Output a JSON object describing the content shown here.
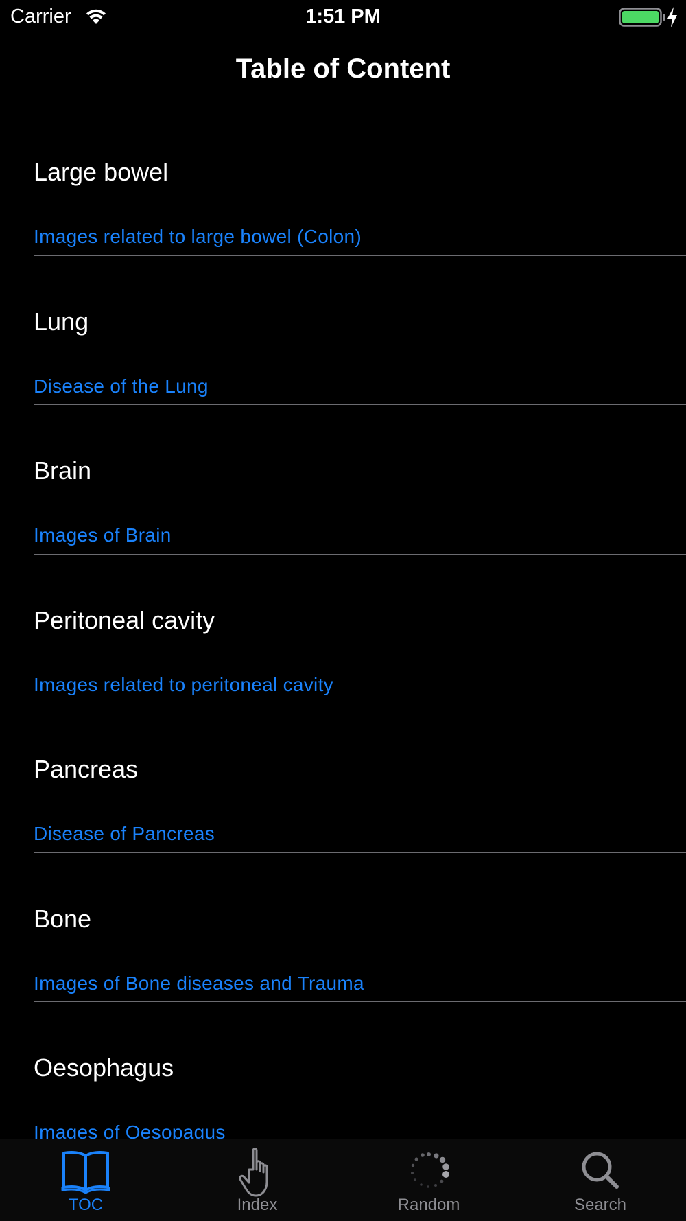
{
  "status_bar": {
    "carrier": "Carrier",
    "time": "1:51 PM",
    "wifi_icon": "wifi-icon",
    "battery_icon": "battery-full-icon",
    "charging_icon": "charging-bolt-icon"
  },
  "nav": {
    "title": "Table of Content"
  },
  "toc": {
    "items": [
      {
        "title": "Large bowel",
        "subtitle": "Images related to large bowel (Colon)"
      },
      {
        "title": "Lung",
        "subtitle": "Disease of the Lung"
      },
      {
        "title": "Brain",
        "subtitle": "Images of Brain"
      },
      {
        "title": "Peritoneal cavity",
        "subtitle": "Images related to peritoneal cavity"
      },
      {
        "title": "Pancreas",
        "subtitle": "Disease of Pancreas"
      },
      {
        "title": "Bone",
        "subtitle": "Images of Bone diseases and Trauma"
      },
      {
        "title": "Oesophagus",
        "subtitle": "Images of Oesopagus"
      }
    ]
  },
  "tabs": [
    {
      "label": "TOC",
      "icon": "book-icon",
      "active": true
    },
    {
      "label": "Index",
      "icon": "pointing-hand-icon",
      "active": false
    },
    {
      "label": "Random",
      "icon": "spinner-icon",
      "active": false
    },
    {
      "label": "Search",
      "icon": "search-icon",
      "active": false
    }
  ],
  "colors": {
    "accent": "#1a82fb",
    "background": "#000000",
    "tab_inactive": "#8e8e93",
    "battery": "#4cd964"
  }
}
